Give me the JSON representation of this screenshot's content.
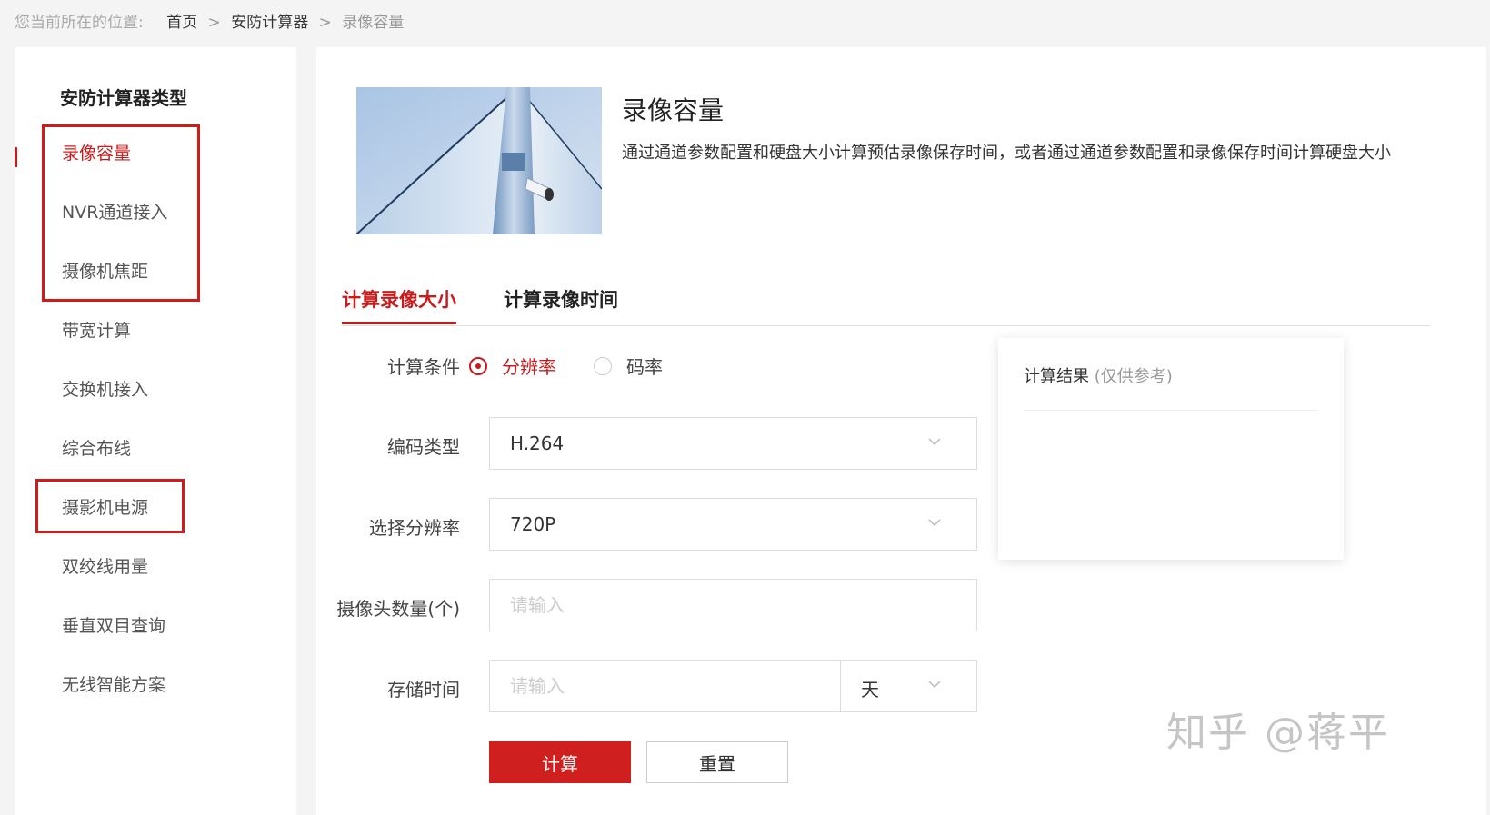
{
  "breadcrumb": {
    "prefix": "您当前所在的位置:",
    "items": [
      "首页",
      "安防计算器",
      "录像容量"
    ],
    "separator": ">"
  },
  "sidebar": {
    "title": "安防计算器类型",
    "items": [
      {
        "label": "录像容量",
        "active": true
      },
      {
        "label": "NVR通道接入"
      },
      {
        "label": "摄像机焦距"
      },
      {
        "label": "带宽计算"
      },
      {
        "label": "交换机接入"
      },
      {
        "label": "综合布线"
      },
      {
        "label": "摄影机电源"
      },
      {
        "label": "双绞线用量"
      },
      {
        "label": "垂直双目查询"
      },
      {
        "label": "无线智能方案"
      }
    ]
  },
  "main": {
    "title": "录像容量",
    "description": "通过通道参数配置和硬盘大小计算预估录像保存时间，或者通过通道参数配置和录像保存时间计算硬盘大小",
    "hero_icon": "surveillance-camera-image",
    "tabs": [
      {
        "label": "计算录像大小",
        "active": true
      },
      {
        "label": "计算录像时间"
      }
    ],
    "form": {
      "condition": {
        "label": "计算条件",
        "options": [
          "分辨率",
          "码率"
        ],
        "selected": "分辨率"
      },
      "encoding": {
        "label": "编码类型",
        "value": "H.264"
      },
      "resolution": {
        "label": "选择分辨率",
        "value": "720P"
      },
      "camera_count": {
        "label": "摄像头数量(个)",
        "placeholder": "请输入"
      },
      "storage_time": {
        "label": "存储时间",
        "placeholder": "请输入",
        "unit": "天"
      },
      "submit_label": "计算",
      "reset_label": "重置"
    },
    "result": {
      "title": "计算结果",
      "note": "(仅供参考)"
    }
  },
  "watermark": "知乎 @蒋平",
  "colors": {
    "accent": "#c81c1c",
    "primary_button": "#d01f1f",
    "highlight_box": "#d11a1a",
    "background": "#f4f4f4"
  }
}
